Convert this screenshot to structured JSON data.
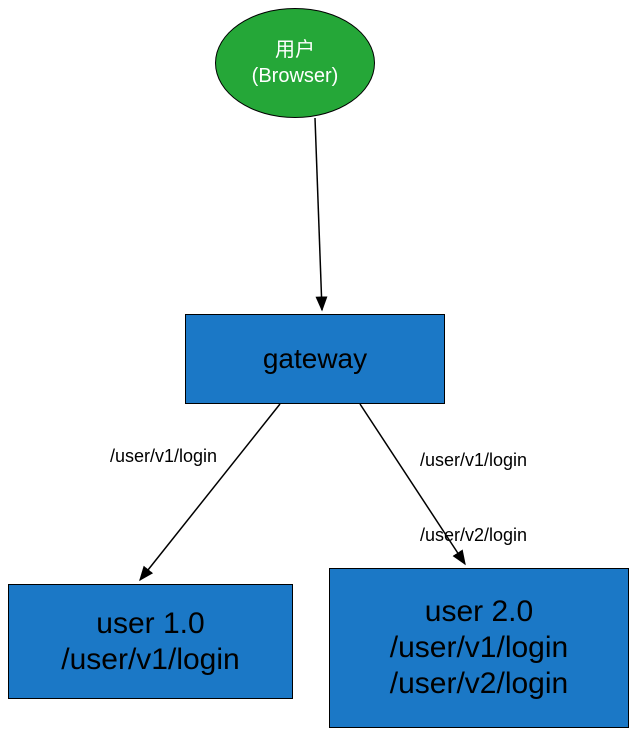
{
  "colors": {
    "ellipse_fill": "#25a738",
    "rect_fill": "#1b78c6",
    "stroke": "#000000"
  },
  "nodes": {
    "user": {
      "type": "ellipse",
      "line1": "用户",
      "line2": "(Browser)"
    },
    "gateway": {
      "type": "rect",
      "label": "gateway"
    },
    "user1": {
      "type": "rect",
      "line1": "user 1.0",
      "line2": "/user/v1/login"
    },
    "user2": {
      "type": "rect",
      "line1": "user 2.0",
      "line2": "/user/v1/login",
      "line3": "/user/v2/login"
    }
  },
  "edges": {
    "e1": {
      "from": "user",
      "to": "gateway",
      "label": ""
    },
    "e2": {
      "from": "gateway",
      "to": "user1",
      "label": "/user/v1/login"
    },
    "e3": {
      "from": "gateway",
      "to": "user2",
      "label_top": "/user/v1/login",
      "label_bottom": "/user/v2/login"
    }
  }
}
